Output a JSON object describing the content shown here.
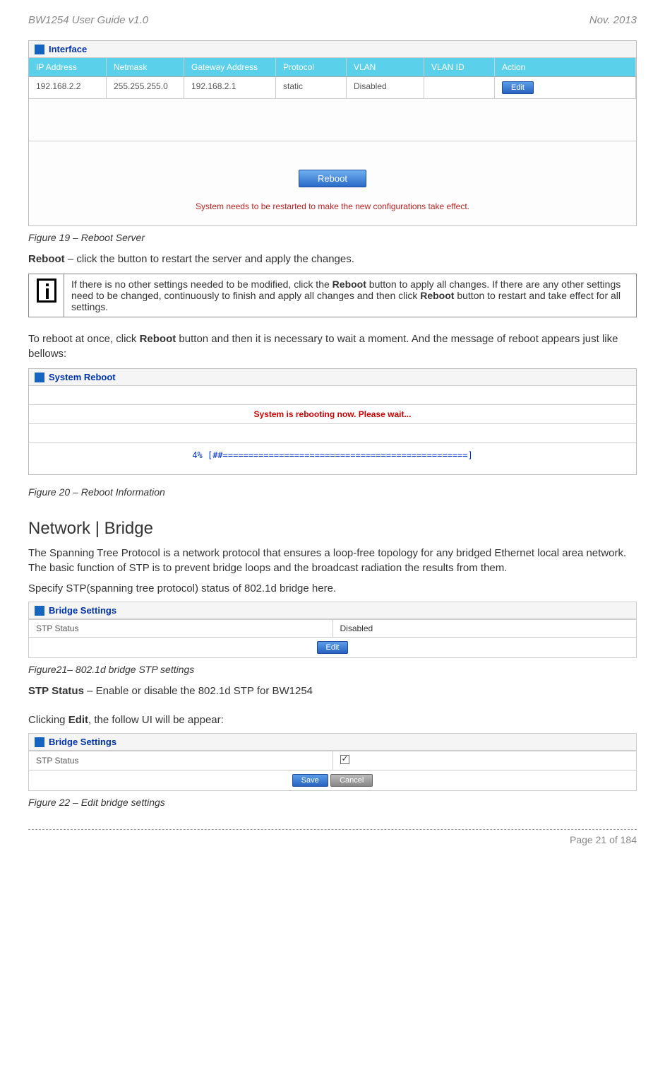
{
  "header": {
    "left": "BW1254 User Guide v1.0",
    "right": "Nov.  2013"
  },
  "fig19": {
    "panel_title": "Interface",
    "columns": {
      "ip": "IP Address",
      "netmask": "Netmask",
      "gateway": "Gateway Address",
      "protocol": "Protocol",
      "vlan": "VLAN",
      "vlanid": "VLAN ID",
      "action": "Action"
    },
    "row": {
      "ip": "192.168.2.2",
      "netmask": "255.255.255.0",
      "gateway": "192.168.2.1",
      "protocol": "static",
      "vlan": "Disabled",
      "vlanid": "",
      "action_btn": "Edit"
    },
    "reboot_btn": "Reboot",
    "restart_msg": "System needs to be restarted to make the new configurations take effect.",
    "caption": "Figure 19 – Reboot Server"
  },
  "text": {
    "reboot_desc_prefix": "Reboot",
    "reboot_desc": " – click the button to restart the server and apply the changes.",
    "info_prefix1": "If there is no other settings needed to be modified, click the ",
    "info_reboot1": "Reboot",
    "info_mid": " button to apply all changes. If there are any other settings need to be changed, continuously to finish and apply all changes and then click ",
    "info_reboot2": "Reboot",
    "info_suffix": " button to restart and take effect for all settings.",
    "to_reboot_prefix": "To reboot at once, click ",
    "to_reboot_bold": "Reboot",
    "to_reboot_suffix": " button and then it is necessary to wait a moment. And the message of reboot appears just like bellows:"
  },
  "fig20": {
    "panel_title": "System Reboot",
    "status_msg": "System is rebooting now. Please wait...",
    "progress": "4% [##================================================]",
    "caption": "Figure 20 – Reboot Information"
  },
  "bridge_section": {
    "title": "Network | Bridge",
    "para1": "The Spanning Tree Protocol is a network protocol that ensures a loop-free topology for any bridged Ethernet local area network. The basic function of STP is to prevent bridge loops and the broadcast radiation the results from them.",
    "para2": "Specify STP(spanning tree protocol) status of 802.1d bridge here."
  },
  "fig21": {
    "panel_title": "Bridge Settings",
    "label": "STP Status",
    "value": "Disabled",
    "edit_btn": "Edit",
    "caption": "Figure21– 802.1d bridge STP settings"
  },
  "stp_desc": {
    "bold": "STP Status",
    "text": " – Enable or disable the 802.1d STP for BW1254"
  },
  "edit_desc": {
    "prefix": "Clicking ",
    "bold": "Edit",
    "suffix": ", the follow UI will be appear:"
  },
  "fig22": {
    "panel_title": "Bridge Settings",
    "label": "STP Status",
    "save_btn": "Save",
    "cancel_btn": "Cancel",
    "caption": "Figure 22 – Edit bridge settings"
  },
  "footer": "Page 21 of 184"
}
